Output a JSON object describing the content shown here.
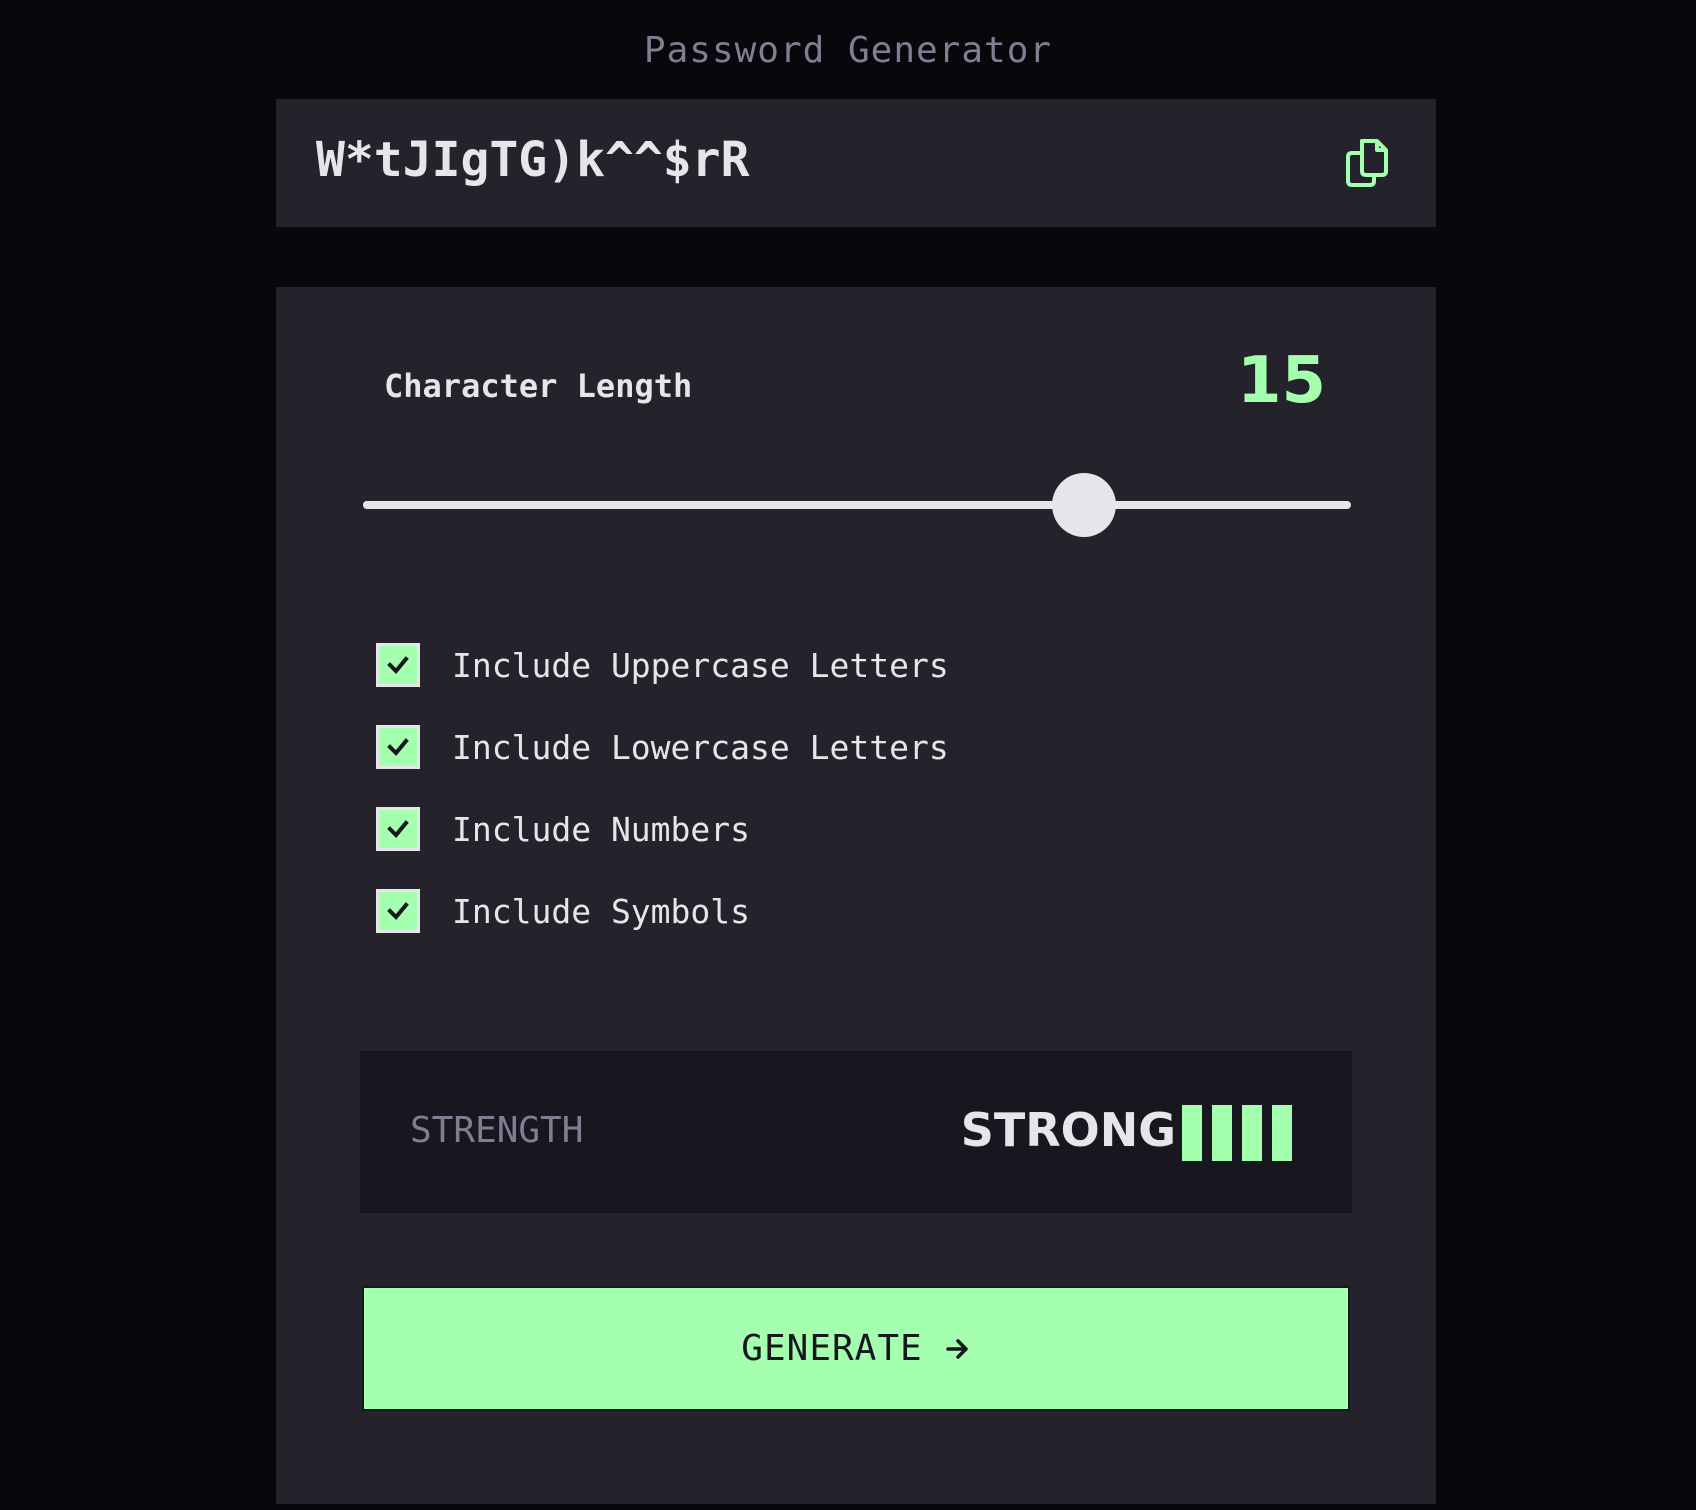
{
  "app": {
    "title": "Password Generator"
  },
  "output": {
    "password": "W*tJIgTG)k^^$rR",
    "copy_icon": "copy-icon"
  },
  "length": {
    "label": "Character Length",
    "value": "15",
    "slider_fraction": 0.73
  },
  "options": [
    {
      "label": "Include Uppercase Letters",
      "checked": true
    },
    {
      "label": "Include Lowercase Letters",
      "checked": true
    },
    {
      "label": "Include Numbers",
      "checked": true
    },
    {
      "label": "Include Symbols",
      "checked": true
    }
  ],
  "strength": {
    "label": "STRENGTH",
    "value": "STRONG",
    "filled_bars": 4,
    "total_bars": 4
  },
  "generate": {
    "label": "GENERATE",
    "icon": "arrow-right-icon"
  },
  "colors": {
    "accent": "#a4ffaf",
    "background": "#08070b",
    "panel": "#24232c",
    "panel_dark": "#18171f",
    "text": "#e6e5ea",
    "muted": "#817d92"
  }
}
